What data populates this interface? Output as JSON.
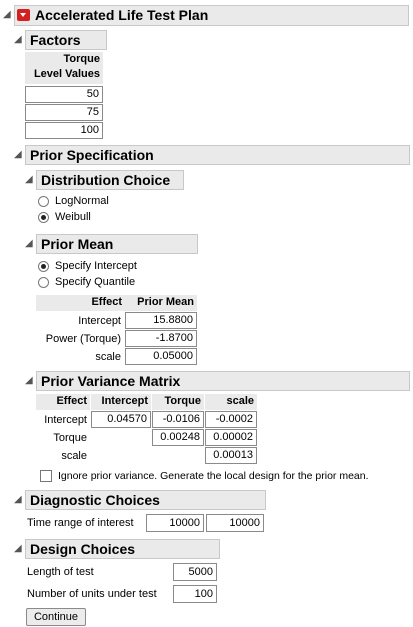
{
  "window": {
    "title": "Accelerated Life Test Plan"
  },
  "factors": {
    "title": "Factors",
    "column_header_line1": "Torque",
    "column_header_line2": "Level Values",
    "levels": [
      "50",
      "75",
      "100"
    ]
  },
  "prior_spec": {
    "title": "Prior Specification"
  },
  "distribution": {
    "title": "Distribution Choice",
    "options": [
      "LogNormal",
      "Weibull"
    ],
    "selected": "Weibull"
  },
  "prior_mean": {
    "title": "Prior Mean",
    "options": [
      "Specify Intercept",
      "Specify Quantile"
    ],
    "selected": "Specify Intercept",
    "table": {
      "headers": [
        "Effect",
        "Prior Mean"
      ],
      "rows": [
        {
          "effect": "Intercept",
          "value": "15.8800"
        },
        {
          "effect": "Power (Torque)",
          "value": "-1.8700"
        },
        {
          "effect": "scale",
          "value": "0.05000"
        }
      ]
    }
  },
  "prior_variance": {
    "title": "Prior Variance Matrix",
    "headers": [
      "Effect",
      "Intercept",
      "Torque",
      "scale"
    ],
    "rows": [
      {
        "effect": "Intercept",
        "intercept": "0.04570",
        "torque": "-0.0106",
        "scale": "-0.0002"
      },
      {
        "effect": "Torque",
        "torque": "0.00248",
        "scale": "0.00002"
      },
      {
        "effect": "scale",
        "scale": "0.00013"
      }
    ],
    "ignore_label": "Ignore prior variance. Generate the local design for the prior mean.",
    "ignore_checked": false
  },
  "diagnostic": {
    "title": "Diagnostic Choices",
    "time_label": "Time range of interest",
    "time_from": "10000",
    "time_to": "10000"
  },
  "design": {
    "title": "Design Choices",
    "length_label": "Length of test",
    "length_value": "5000",
    "units_label": "Number of units under test",
    "units_value": "100"
  },
  "continue_label": "Continue",
  "icons": {
    "disclosure": "disclosure-triangle-icon",
    "menu": "red-triangle-menu-icon"
  },
  "colors": {
    "header_bg": "#eaeaea",
    "menu_red": "#d42020"
  }
}
